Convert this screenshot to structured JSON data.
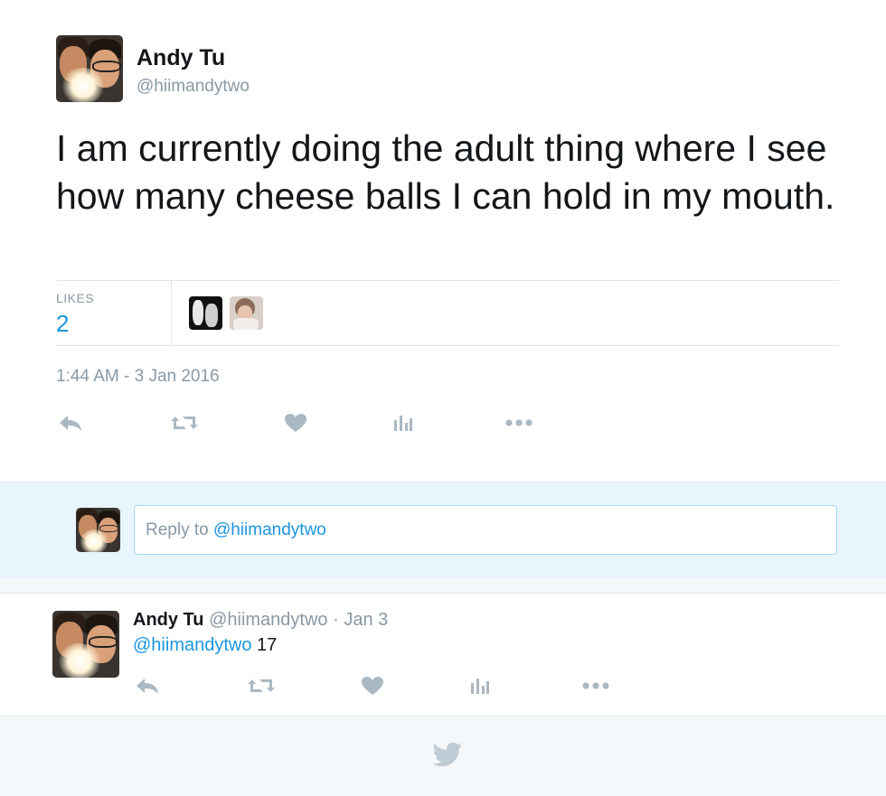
{
  "tweet": {
    "author_name": "Andy Tu",
    "author_handle": "@hiimandytwo",
    "text": "I am currently doing the adult thing where I see how many cheese balls I can hold in my mouth.",
    "likes_label": "LIKES",
    "likes_count": "2",
    "timestamp": "1:44 AM - 3 Jan 2016"
  },
  "icons": {
    "actions": [
      "reply-icon",
      "retweet-icon",
      "like-icon",
      "analytics-icon",
      "more-icon"
    ],
    "footer": "twitter-bird-icon"
  },
  "reply_composer": {
    "placeholder_prefix": "Reply to ",
    "placeholder_handle": "@hiimandytwo"
  },
  "reply_tweet": {
    "author_name": "Andy Tu",
    "author_handle": "@hiimandytwo",
    "date_separator": " · ",
    "date": "Jan 3",
    "mention": "@hiimandytwo",
    "text": " 17"
  },
  "colors": {
    "link": "#1b95e0",
    "muted": "#8899a6",
    "reply_band": "#e8f5fd",
    "footer": "#f5f8fa"
  }
}
